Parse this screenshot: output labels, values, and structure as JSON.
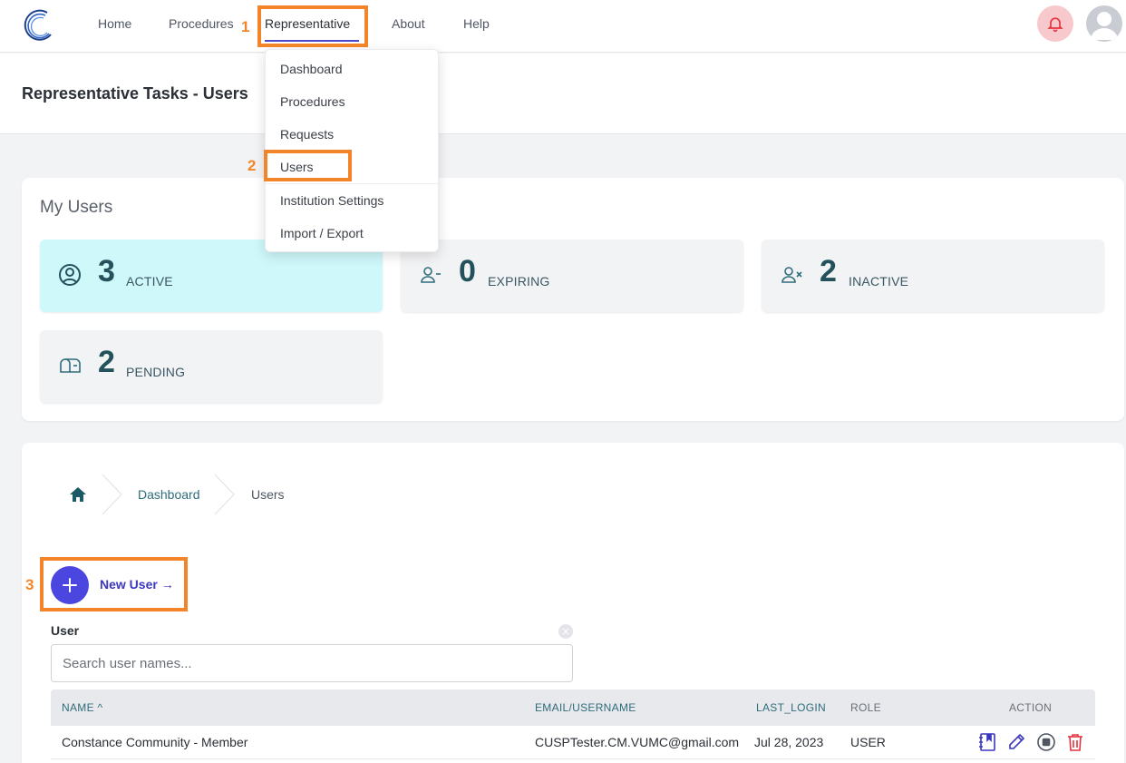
{
  "nav": {
    "links": [
      "Home",
      "Procedures",
      "Representative",
      "About",
      "Help"
    ]
  },
  "page": {
    "title": "Representative Tasks - Users"
  },
  "dropdown": {
    "items": [
      "Dashboard",
      "Procedures",
      "Requests",
      "Users",
      "Institution Settings",
      "Import / Export"
    ]
  },
  "my_users": {
    "title": "My Users",
    "stats": [
      {
        "value": "3",
        "label": "ACTIVE",
        "icon": "user-circle-icon"
      },
      {
        "value": "0",
        "label": "EXPIRING",
        "icon": "user-minus-icon"
      },
      {
        "value": "2",
        "label": "INACTIVE",
        "icon": "user-x-icon"
      },
      {
        "value": "2",
        "label": "PENDING",
        "icon": "mailbox-icon"
      }
    ]
  },
  "breadcrumb": {
    "dashboard": "Dashboard",
    "current": "Users"
  },
  "new_user": {
    "label": "New User →"
  },
  "search": {
    "label": "User",
    "placeholder": "Search user names..."
  },
  "table": {
    "headers": {
      "name": "NAME ^",
      "email": "EMAIL/USERNAME",
      "last_login": "LAST_LOGIN",
      "role": "ROLE",
      "action": "ACTION"
    },
    "rows": [
      {
        "name": "Constance Community - Member",
        "email": "CUSPTester.CM.VUMC@gmail.com",
        "last_login": "Jul 28, 2023",
        "role": "USER"
      }
    ]
  },
  "annotations": [
    "1",
    "2",
    "3"
  ],
  "colors": {
    "accent": "#4c46e0",
    "highlight": "#f28529",
    "active_card": "#cff8fb",
    "bell_bg": "#f8c9cc"
  }
}
